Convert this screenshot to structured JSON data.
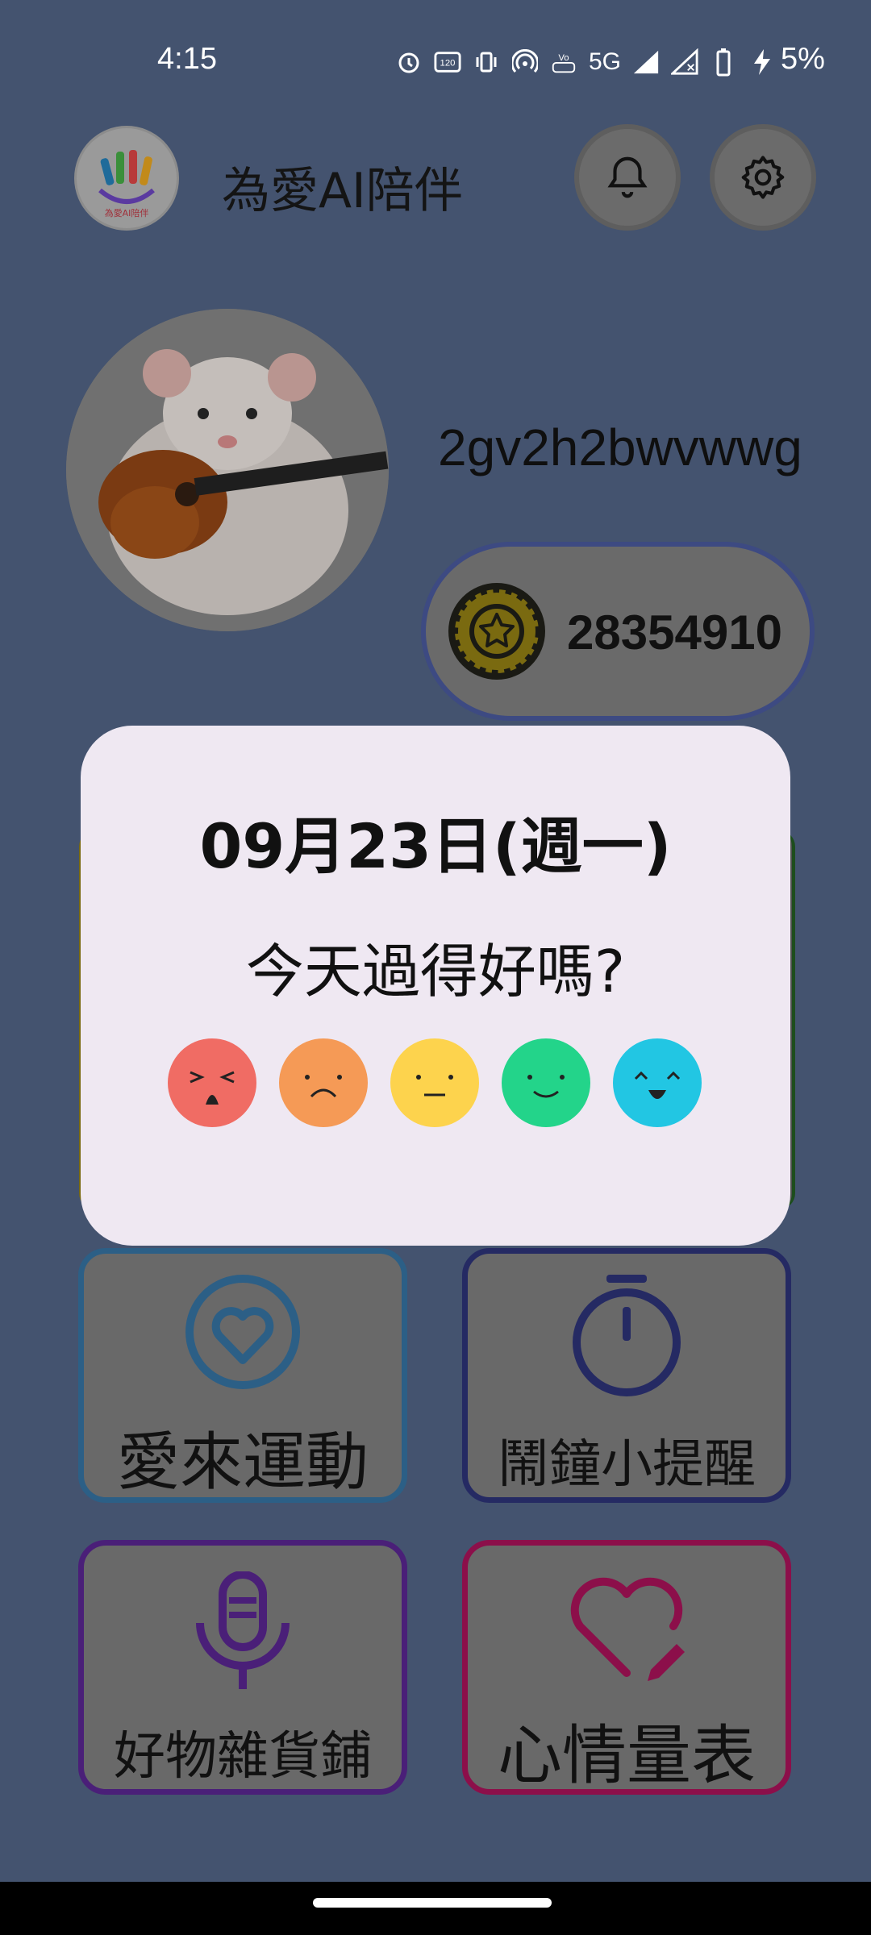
{
  "status_bar": {
    "time": "4:15",
    "network": "5G",
    "battery": "5%",
    "icons": [
      "alarm-icon",
      "refresh-rate-icon",
      "vibrate-icon",
      "hotspot-icon",
      "volte-icon",
      "signal-icon",
      "signal-icon",
      "battery-icon",
      "charging-icon"
    ]
  },
  "header": {
    "app_title": "為愛AI陪伴",
    "logo_icon": "hand-logo-icon",
    "bell_icon": "bell-icon",
    "settings_icon": "gear-icon"
  },
  "profile": {
    "username": "2gv2h2bwvwwg",
    "coins": "28354910",
    "coin_icon": "coin-star-icon",
    "avatar_icon": "rat-with-guitar-photo"
  },
  "tiles": [
    {
      "label": "愛來運動",
      "icon": "heart-circle-icon",
      "border": "#2c5f86"
    },
    {
      "label": "鬧鐘小提醒",
      "icon": "stopwatch-icon",
      "border": "#252a63"
    },
    {
      "label": "好物雜貨鋪",
      "icon": "microphone-icon",
      "border": "#4a1f78"
    },
    {
      "label": "心情量表",
      "icon": "heart-edit-icon",
      "border": "#8c0f4a"
    }
  ],
  "dialog": {
    "date": "09月23日(週一)",
    "question": "今天過得好嗎?",
    "moods": [
      {
        "name": "angry",
        "color": "#f06c64"
      },
      {
        "name": "sad",
        "color": "#f59a56"
      },
      {
        "name": "neutral",
        "color": "#fdd34d"
      },
      {
        "name": "happy",
        "color": "#23d48a"
      },
      {
        "name": "very-happy",
        "color": "#22c6e3"
      }
    ]
  }
}
